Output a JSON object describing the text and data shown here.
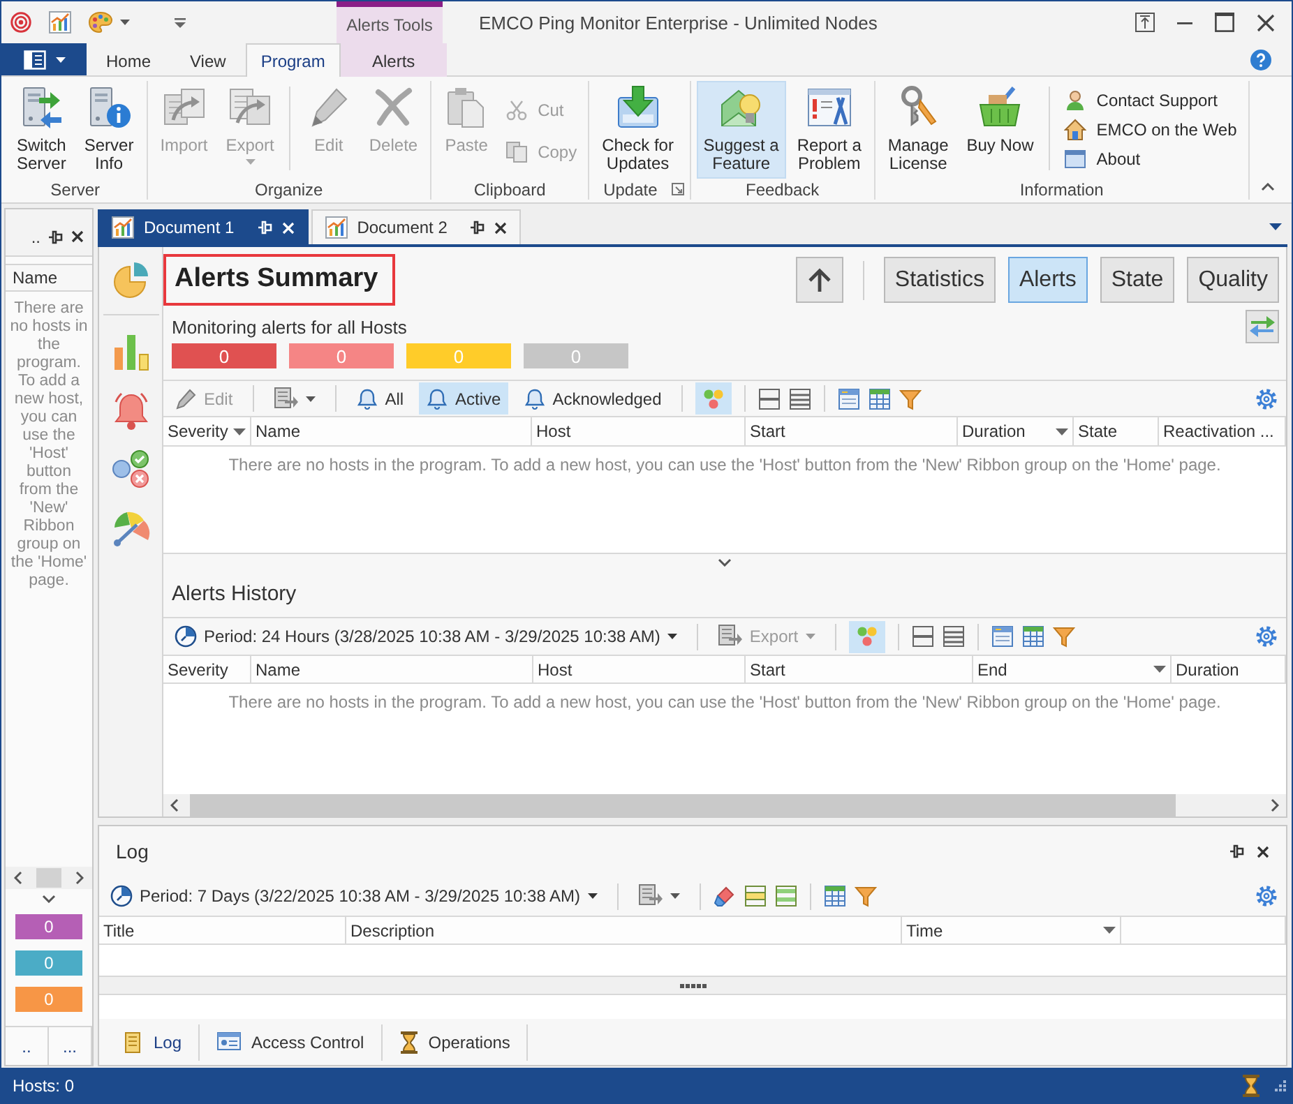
{
  "window": {
    "title": "EMCO Ping Monitor Enterprise - Unlimited Nodes",
    "context_group": "Alerts Tools"
  },
  "ribbon": {
    "tabs": [
      {
        "label": "Home",
        "selected": false,
        "contextual": false
      },
      {
        "label": "View",
        "selected": false,
        "contextual": false
      },
      {
        "label": "Program",
        "selected": true,
        "contextual": false
      },
      {
        "label": "Alerts",
        "selected": false,
        "contextual": true
      }
    ],
    "groups": [
      {
        "label": "Server",
        "launcher": false,
        "items": [
          {
            "kind": "large",
            "label": "Switch\nServer",
            "disabled": false,
            "highlighted": false,
            "dropdown": false
          },
          {
            "kind": "large",
            "label": "Server\nInfo",
            "disabled": false,
            "highlighted": false,
            "dropdown": false
          }
        ]
      },
      {
        "label": "Organize",
        "launcher": false,
        "items": [
          {
            "kind": "large",
            "label": "Import",
            "disabled": true,
            "highlighted": false,
            "dropdown": false
          },
          {
            "kind": "large",
            "label": "Export",
            "disabled": true,
            "highlighted": false,
            "dropdown": true
          },
          {
            "kind": "separator"
          },
          {
            "kind": "large",
            "label": "Edit",
            "disabled": true,
            "highlighted": false,
            "dropdown": false
          },
          {
            "kind": "large",
            "label": "Delete",
            "disabled": true,
            "highlighted": false,
            "dropdown": false
          }
        ]
      },
      {
        "label": "Clipboard",
        "launcher": false,
        "items": [
          {
            "kind": "large",
            "label": "Paste",
            "disabled": true,
            "highlighted": false,
            "dropdown": false
          },
          {
            "kind": "small",
            "label": "Cut",
            "disabled": true,
            "highlighted": false,
            "dropdown": false
          },
          {
            "kind": "small",
            "label": "Copy",
            "disabled": true,
            "highlighted": false,
            "dropdown": false
          }
        ]
      },
      {
        "label": "Update",
        "launcher": true,
        "items": [
          {
            "kind": "large",
            "label": "Check for\nUpdates",
            "disabled": false,
            "highlighted": false,
            "dropdown": false
          }
        ]
      },
      {
        "label": "Feedback",
        "launcher": false,
        "items": [
          {
            "kind": "large",
            "label": "Suggest a\nFeature",
            "disabled": false,
            "highlighted": true,
            "dropdown": false
          },
          {
            "kind": "large",
            "label": "Report a\nProblem",
            "disabled": false,
            "highlighted": false,
            "dropdown": false
          }
        ]
      },
      {
        "label": "Information",
        "launcher": false,
        "items": [
          {
            "kind": "large",
            "label": "Manage\nLicense",
            "disabled": false,
            "highlighted": false,
            "dropdown": false
          },
          {
            "kind": "large",
            "label": "Buy Now",
            "disabled": false,
            "highlighted": false,
            "dropdown": false
          },
          {
            "kind": "separator"
          },
          {
            "kind": "small",
            "label": "Contact Support",
            "disabled": false,
            "highlighted": false,
            "dropdown": false
          },
          {
            "kind": "small",
            "label": "EMCO on the Web",
            "disabled": false,
            "highlighted": false,
            "dropdown": false
          },
          {
            "kind": "small",
            "label": "About",
            "disabled": false,
            "highlighted": false,
            "dropdown": false
          }
        ]
      }
    ]
  },
  "left_panel": {
    "title": "..",
    "column": "Name",
    "message": "There are no hosts in the program. To add a new host, you can use the 'Host' button from the 'New' Ribbon group on the 'Home' page.",
    "counters": [
      {
        "value": "0",
        "color": "#b55fb5"
      },
      {
        "value": "0",
        "color": "#4bacc6"
      },
      {
        "value": "0",
        "color": "#f79646"
      }
    ],
    "buttons": [
      "..",
      "..."
    ]
  },
  "documents": {
    "tabs": [
      {
        "label": "Document 1",
        "selected": true
      },
      {
        "label": "Document 2",
        "selected": false
      }
    ]
  },
  "summary": {
    "title": "Alerts Summary",
    "views": [
      {
        "label": "Statistics",
        "selected": false
      },
      {
        "label": "Alerts",
        "selected": true
      },
      {
        "label": "State",
        "selected": false
      },
      {
        "label": "Quality",
        "selected": false
      }
    ],
    "subtitle": "Monitoring alerts for all Hosts",
    "counters": [
      {
        "value": "0",
        "color": "#e05151"
      },
      {
        "value": "0",
        "color": "#f58585"
      },
      {
        "value": "0",
        "color": "#ffcc29"
      },
      {
        "value": "0",
        "color": "#c6c6c6"
      }
    ]
  },
  "alerts": {
    "toolbar": {
      "edit": {
        "label": "Edit",
        "disabled": true
      },
      "filters": [
        {
          "label": "All",
          "selected": false
        },
        {
          "label": "Active",
          "selected": true
        },
        {
          "label": "Acknowledged",
          "selected": false
        }
      ],
      "color_toggle": {
        "selected": true
      }
    },
    "columns": [
      {
        "label": "Severity",
        "sort_arrow": true
      },
      {
        "label": "Name",
        "sort_arrow": false
      },
      {
        "label": "Host",
        "sort_arrow": false
      },
      {
        "label": "Start",
        "sort_arrow": false
      },
      {
        "label": "Duration",
        "sort_arrow": true
      },
      {
        "label": "State",
        "sort_arrow": false
      },
      {
        "label": "Reactivation ...",
        "sort_arrow": false
      }
    ],
    "empty_message": "There are no hosts in the program. To add a new host, you can use the 'Host' button from the 'New' Ribbon group on the 'Home' page."
  },
  "history": {
    "title": "Alerts History",
    "toolbar": {
      "period": "Period: 24 Hours (3/28/2025 10:38 AM - 3/29/2025 10:38 AM)",
      "export": {
        "label": "Export",
        "disabled": true
      },
      "color_toggle": {
        "selected": true
      }
    },
    "columns": [
      {
        "label": "Severity",
        "sort_arrow": false
      },
      {
        "label": "Name",
        "sort_arrow": false
      },
      {
        "label": "Host",
        "sort_arrow": false
      },
      {
        "label": "Start",
        "sort_arrow": false
      },
      {
        "label": "End",
        "sort_arrow": true
      },
      {
        "label": "Duration",
        "sort_arrow": false
      }
    ],
    "empty_message": "There are no hosts in the program. To add a new host, you can use the 'Host' button from the 'New' Ribbon group on the 'Home' page."
  },
  "log": {
    "title": "Log",
    "toolbar": {
      "period": "Period: 7 Days (3/22/2025 10:38 AM - 3/29/2025 10:38 AM)"
    },
    "columns": [
      {
        "label": "Title",
        "sort_arrow": false
      },
      {
        "label": "Description",
        "sort_arrow": false
      },
      {
        "label": "Time",
        "sort_arrow": true
      }
    ],
    "tabs": [
      {
        "label": "Log",
        "selected": true
      },
      {
        "label": "Access Control",
        "selected": false
      },
      {
        "label": "Operations",
        "selected": false
      }
    ]
  },
  "status_bar": {
    "text": "Hosts: 0"
  }
}
